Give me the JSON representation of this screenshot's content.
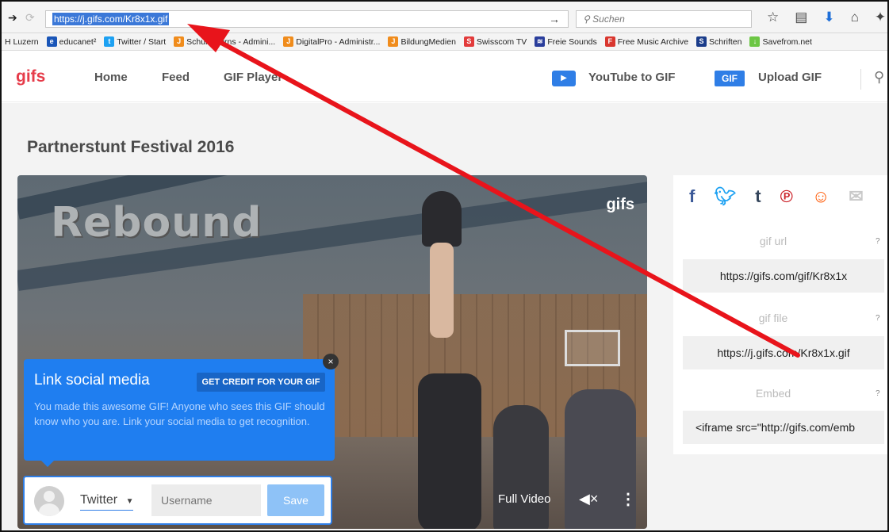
{
  "browser": {
    "url": "https://j.gifs.com/Kr8x1x.gif",
    "search_placeholder": "Suchen",
    "bookmarks": [
      {
        "label": "H Luzern",
        "icon": "",
        "color": ""
      },
      {
        "label": "educanet²",
        "icon": "e",
        "color": "#1a56b8"
      },
      {
        "label": "Twitter / Start",
        "icon": "t",
        "color": "#1da1f2"
      },
      {
        "label": "Schule Kerns - Admini...",
        "icon": "J",
        "color": "#f08c1c"
      },
      {
        "label": "DigitalPro - Administr...",
        "icon": "J",
        "color": "#f08c1c"
      },
      {
        "label": "BildungMedien",
        "icon": "J",
        "color": "#f08c1c"
      },
      {
        "label": "Swisscom TV",
        "icon": "S",
        "color": "#e23b3b"
      },
      {
        "label": "Freie Sounds",
        "icon": "≋",
        "color": "#2a3e9c"
      },
      {
        "label": "Free Music Archive",
        "icon": "F",
        "color": "#d9362e"
      },
      {
        "label": "Schriften",
        "icon": "S",
        "color": "#1a3c8a"
      },
      {
        "label": "Savefrom.net",
        "icon": "↓",
        "color": "#6cc644"
      }
    ]
  },
  "site": {
    "logo": "gifs",
    "nav": [
      "Home",
      "Feed",
      "GIF Player"
    ],
    "youtube_to_gif": "YouTube to GIF",
    "gif_badge": "GIF",
    "upload_gif": "Upload GIF"
  },
  "page": {
    "title": "Partnerstunt Festival 2016"
  },
  "video": {
    "overlay_text": "Rebound",
    "watermark": "gifs",
    "full_video": "Full Video"
  },
  "popup": {
    "title": "Link social media",
    "credit_button": "GET CREDIT FOR YOUR GIF",
    "body": "You made this awesome GIF! Anyone who sees this GIF should know who you are. Link your social media to get recognition.",
    "close": "×",
    "platform": "Twitter",
    "username_placeholder": "Username",
    "save": "Save"
  },
  "share": {
    "gif_url_label": "gif url",
    "gif_url": "https://gifs.com/gif/Kr8x1x",
    "gif_file_label": "gif file",
    "gif_file": "https://j.gifs.com/Kr8x1x.gif",
    "embed_label": "Embed",
    "embed": "<iframe src=\"http://gifs.com/emb",
    "help": "?"
  },
  "colors": {
    "brand": "#e63c4a",
    "accent": "#2f7ee6",
    "annotation": "#e8141b"
  }
}
